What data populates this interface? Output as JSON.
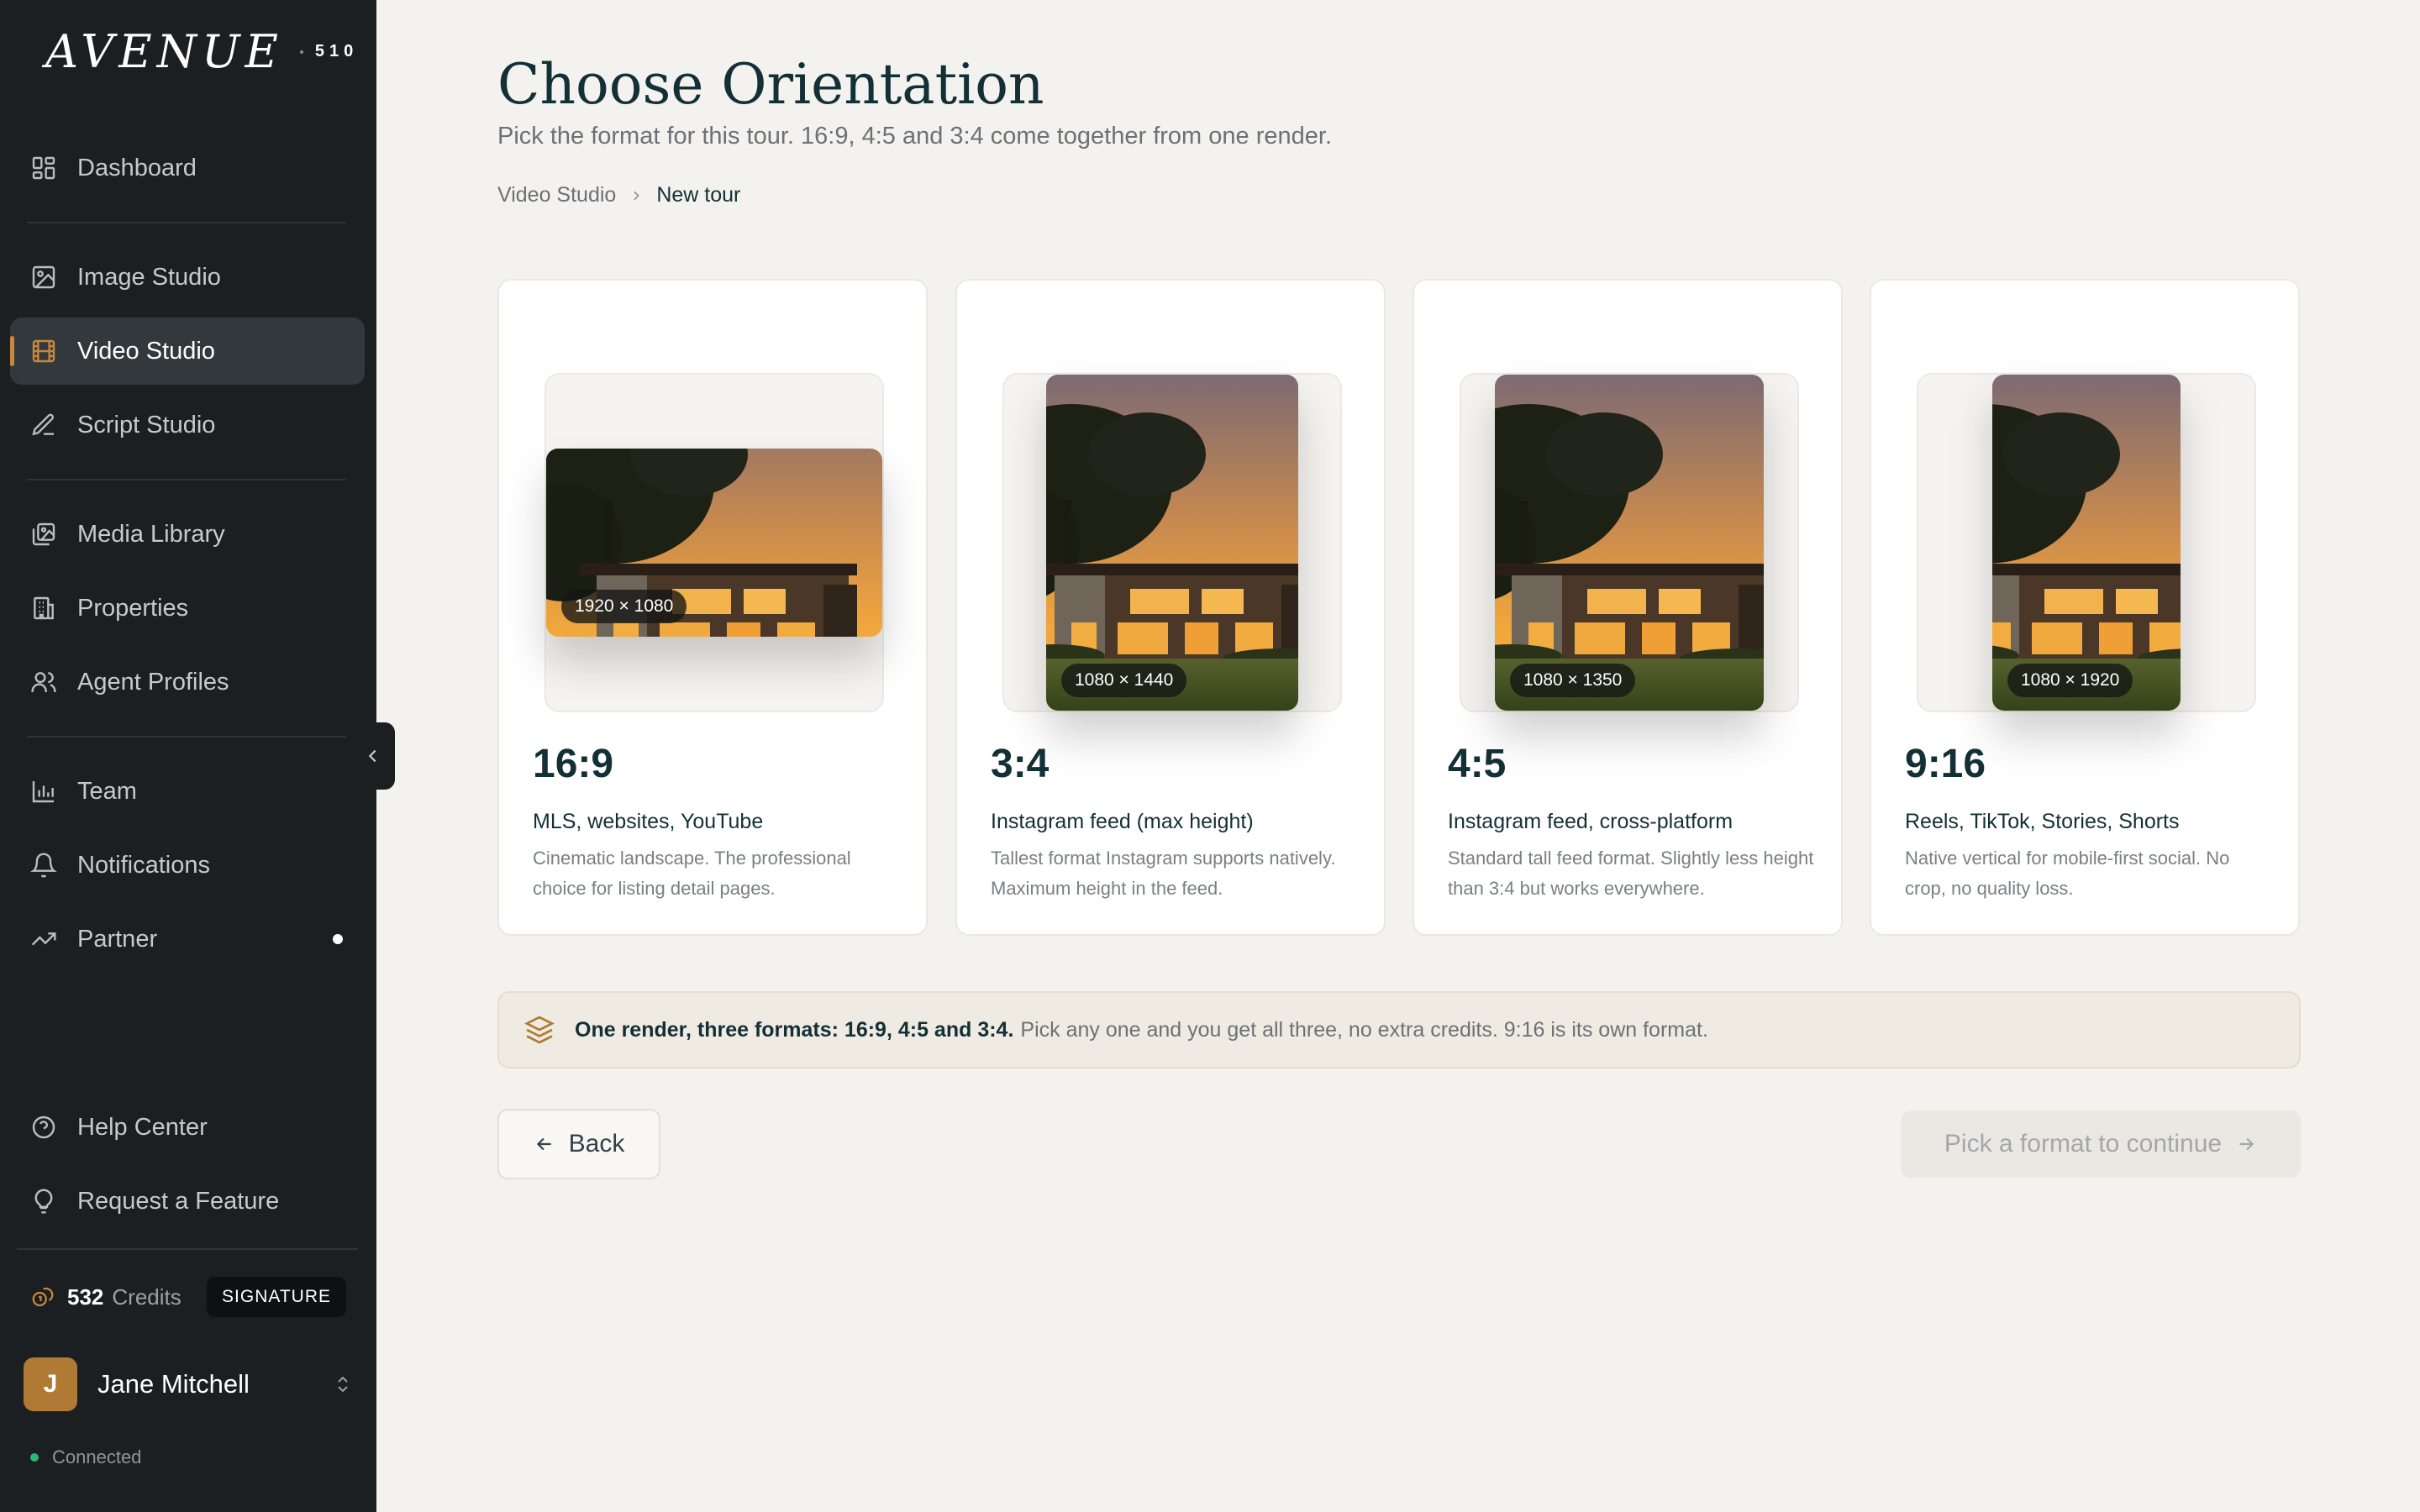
{
  "brand": {
    "word": "AVENUE",
    "number": "510"
  },
  "sidebar": {
    "items": [
      {
        "label": "Dashboard",
        "icon": "dashboard-icon"
      },
      {
        "label": "Image Studio",
        "icon": "image-icon"
      },
      {
        "label": "Video Studio",
        "icon": "film-icon",
        "active": true
      },
      {
        "label": "Script Studio",
        "icon": "pen-icon"
      },
      {
        "label": "Media Library",
        "icon": "media-library-icon"
      },
      {
        "label": "Properties",
        "icon": "building-icon"
      },
      {
        "label": "Agent Profiles",
        "icon": "users-icon"
      },
      {
        "label": "Team",
        "icon": "bar-chart-icon"
      },
      {
        "label": "Notifications",
        "icon": "bell-icon"
      },
      {
        "label": "Partner",
        "icon": "trending-up-icon"
      },
      {
        "label": "Help Center",
        "icon": "help-circle-icon"
      },
      {
        "label": "Request a Feature",
        "icon": "lightbulb-icon"
      }
    ],
    "credits": {
      "value": "532",
      "label": "Credits",
      "plan": "SIGNATURE"
    },
    "user": {
      "initial": "J",
      "name": "Jane Mitchell"
    },
    "status": "Connected"
  },
  "header": {
    "title": "Choose Orientation",
    "subtitle": "Pick the format for this tour. 16:9, 4:5 and 3:4 come together from one render.",
    "breadcrumb": [
      "Video Studio",
      "New tour"
    ]
  },
  "formats": [
    {
      "ratio": "16:9",
      "dims": "1920 × 1080",
      "heading": "MLS, websites, YouTube",
      "desc": "Cinematic landscape. The professional choice for listing detail pages."
    },
    {
      "ratio": "3:4",
      "dims": "1080 × 1440",
      "heading": "Instagram feed (max height)",
      "desc": "Tallest format Instagram supports natively. Maximum height in the feed."
    },
    {
      "ratio": "4:5",
      "dims": "1080 × 1350",
      "heading": "Instagram feed, cross-platform",
      "desc": "Standard tall feed format. Slightly less height than 3:4 but works everywhere."
    },
    {
      "ratio": "9:16",
      "dims": "1080 × 1920",
      "heading": "Reels, TikTok, Stories, Shorts",
      "desc": "Native vertical for mobile-first social. No crop, no quality loss."
    }
  ],
  "info": {
    "strong": "One render, three formats: 16:9, 4:5 and 3:4.",
    "rest": "Pick any one and you get all three, no extra credits. 9:16 is its own format."
  },
  "actions": {
    "back": "Back",
    "next": "Pick a format to continue"
  },
  "colors": {
    "sidebar_bg": "#1b1f22",
    "accent": "#c8873a",
    "title": "#133036",
    "page_bg": "#f4f2ee"
  }
}
